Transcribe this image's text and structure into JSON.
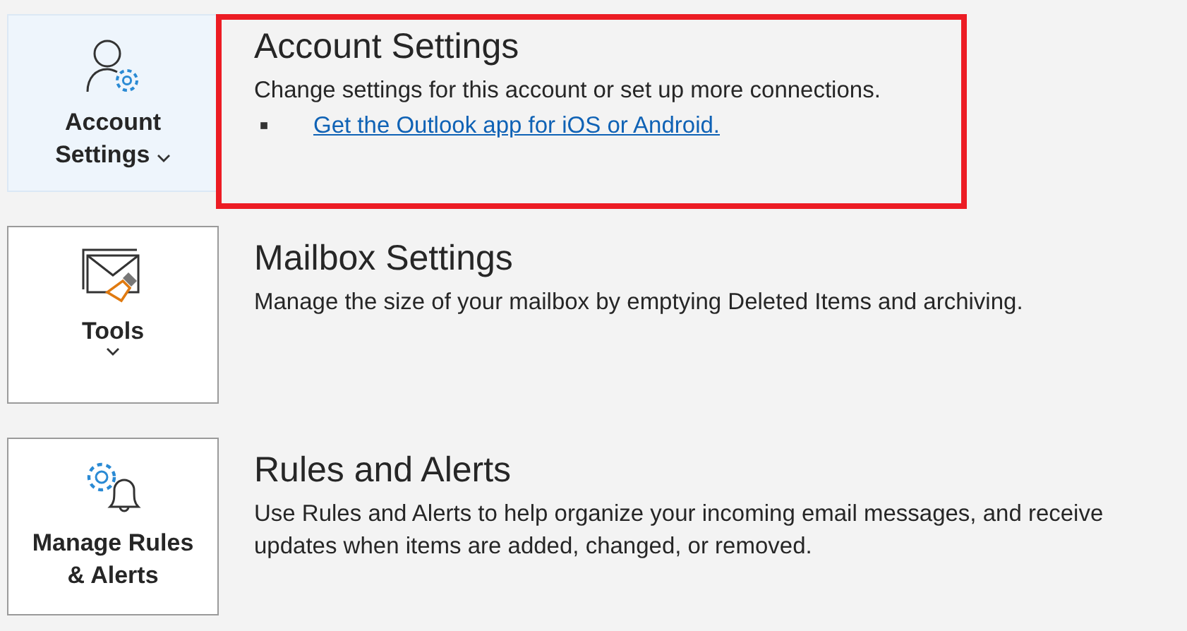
{
  "sections": [
    {
      "tile": {
        "label": "Account Settings",
        "kind": "dropdown-inline",
        "selected": true
      },
      "title": "Account Settings",
      "description": "Change settings for this account or set up more connections.",
      "highlighted": true,
      "bullets": [
        {
          "marker": "■",
          "link": "Get the Outlook app for iOS or Android."
        }
      ]
    },
    {
      "tile": {
        "label": "Tools",
        "kind": "dropdown-below",
        "selected": false
      },
      "title": "Mailbox Settings",
      "description": "Manage the size of your mailbox by emptying Deleted Items and archiving.",
      "highlighted": false
    },
    {
      "tile": {
        "label": "Manage Rules & Alerts",
        "kind": "plain",
        "selected": false
      },
      "title": "Rules and Alerts",
      "description": "Use Rules and Alerts to help organize your incoming email messages, and receive updates when items are added, changed, or removed.",
      "highlighted": false
    }
  ]
}
